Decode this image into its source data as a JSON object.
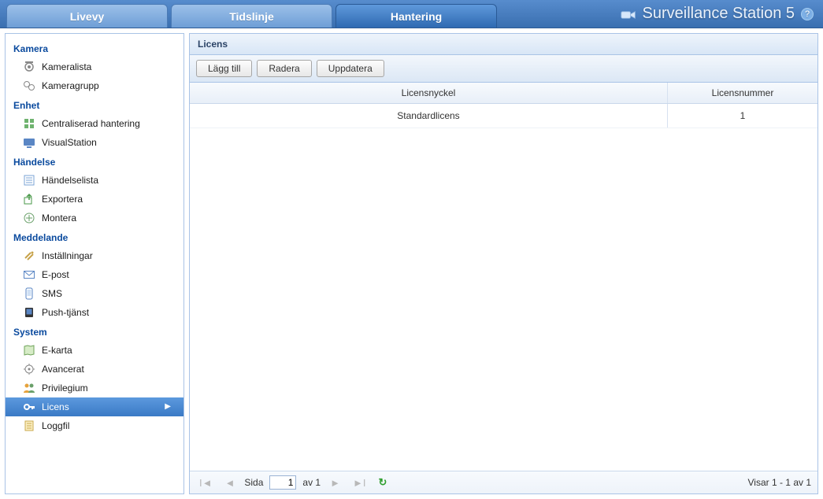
{
  "app": {
    "title": "Surveillance Station 5"
  },
  "tabs": [
    {
      "label": "Livevy",
      "active": false
    },
    {
      "label": "Tidslinje",
      "active": false
    },
    {
      "label": "Hantering",
      "active": true
    }
  ],
  "sidebar": {
    "sections": [
      {
        "title": "Kamera",
        "items": [
          {
            "label": "Kameralista",
            "icon": "camera-icon"
          },
          {
            "label": "Kameragrupp",
            "icon": "camera-group-icon"
          }
        ]
      },
      {
        "title": "Enhet",
        "items": [
          {
            "label": "Centraliserad hantering",
            "icon": "centralized-icon"
          },
          {
            "label": "VisualStation",
            "icon": "visualstation-icon"
          }
        ]
      },
      {
        "title": "Händelse",
        "items": [
          {
            "label": "Händelselista",
            "icon": "event-list-icon"
          },
          {
            "label": "Exportera",
            "icon": "export-icon"
          },
          {
            "label": "Montera",
            "icon": "mount-icon"
          }
        ]
      },
      {
        "title": "Meddelande",
        "items": [
          {
            "label": "Inställningar",
            "icon": "settings-icon"
          },
          {
            "label": "E-post",
            "icon": "mail-icon"
          },
          {
            "label": "SMS",
            "icon": "sms-icon"
          },
          {
            "label": "Push-tjänst",
            "icon": "push-icon"
          }
        ]
      },
      {
        "title": "System",
        "items": [
          {
            "label": "E-karta",
            "icon": "map-icon"
          },
          {
            "label": "Avancerat",
            "icon": "advanced-icon"
          },
          {
            "label": "Privilegium",
            "icon": "privilege-icon"
          },
          {
            "label": "Licens",
            "icon": "key-icon",
            "selected": true
          },
          {
            "label": "Loggfil",
            "icon": "log-icon"
          }
        ]
      }
    ]
  },
  "panel": {
    "title": "Licens",
    "toolbar": {
      "add": "Lägg till",
      "delete": "Radera",
      "update": "Uppdatera"
    },
    "columns": {
      "key": "Licensnyckel",
      "number": "Licensnummer"
    },
    "rows": [
      {
        "key": "Standardlicens",
        "number": "1"
      }
    ],
    "pager": {
      "page_label": "Sida",
      "page_value": "1",
      "of_label": "av 1",
      "status": "Visar 1 - 1 av 1"
    }
  }
}
